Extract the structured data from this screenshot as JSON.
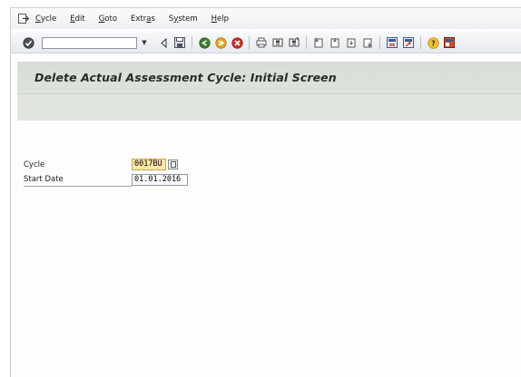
{
  "menu": {
    "items": [
      {
        "pre": "",
        "key": "C",
        "post": "ycle"
      },
      {
        "pre": "",
        "key": "E",
        "post": "dit"
      },
      {
        "pre": "",
        "key": "G",
        "post": "oto"
      },
      {
        "pre": "Extr",
        "key": "a",
        "post": "s"
      },
      {
        "pre": "S",
        "key": "y",
        "post": "stem"
      },
      {
        "pre": "",
        "key": "H",
        "post": "elp"
      }
    ]
  },
  "toolbar": {
    "command_value": ""
  },
  "title": "Delete Actual Assessment Cycle: Initial Screen",
  "form": {
    "cycle_label": "Cycle",
    "cycle_value": "0017BU",
    "start_date_label": "Start Date",
    "start_date_value": "01.01.2016"
  },
  "colors": {
    "title_band": "#dee4dd",
    "required_field": "#fbe7a8"
  }
}
